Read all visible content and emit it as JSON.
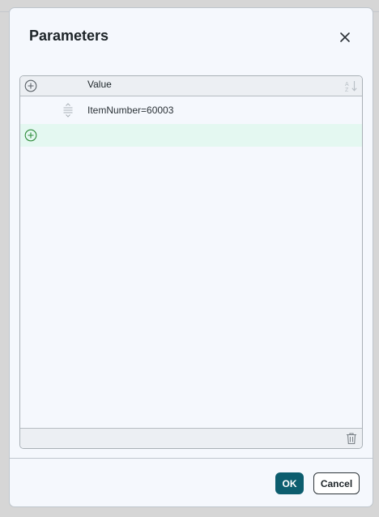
{
  "dialog": {
    "title": "Parameters"
  },
  "grid": {
    "column_header": "Value",
    "rows": [
      {
        "value": "ItemNumber=60003"
      }
    ]
  },
  "buttons": {
    "ok_label": "OK",
    "cancel_label": "Cancel"
  },
  "icons": {
    "close": "close-icon",
    "add": "plus-circle-icon",
    "sort": "sort-az-icon",
    "drag": "drag-handle-icon",
    "delete": "trash-icon"
  },
  "colors": {
    "primary_button": "#0c5d6e",
    "new_row_highlight": "#e4f8f1",
    "add_icon_green": "#2e8b3a"
  }
}
